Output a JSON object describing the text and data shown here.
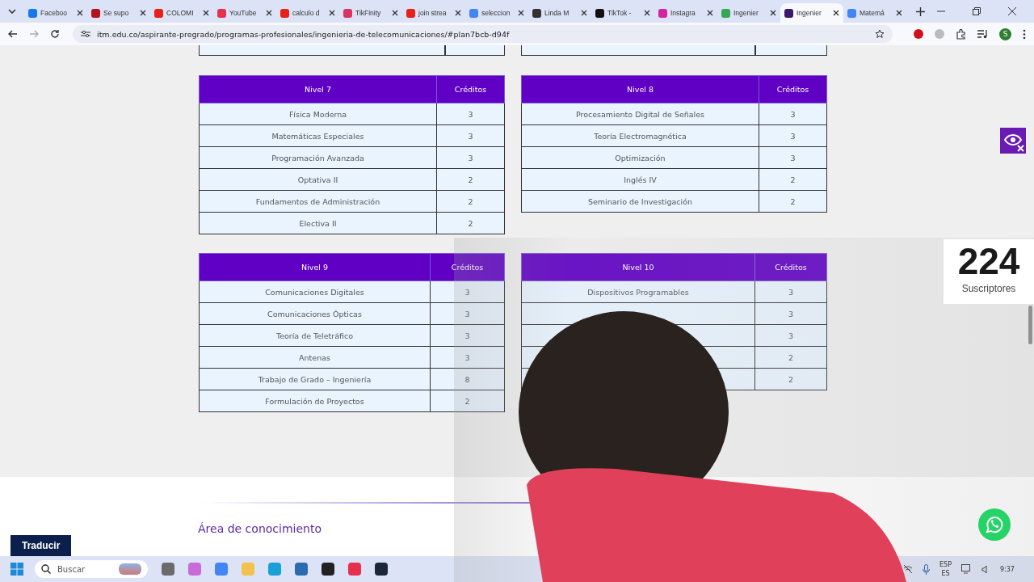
{
  "browser": {
    "tabs": [
      {
        "title": "Faceboo",
        "color": "#1877f2",
        "selected": false
      },
      {
        "title": "Se supo",
        "color": "#b3121b",
        "selected": false
      },
      {
        "title": "COLOMI",
        "color": "#e62117",
        "selected": false
      },
      {
        "title": "YouTube",
        "color": "#e6304d",
        "selected": false
      },
      {
        "title": "calculo d",
        "color": "#e62117",
        "selected": false
      },
      {
        "title": "TikFinity",
        "color": "#d8345f",
        "selected": false
      },
      {
        "title": "join strea",
        "color": "#e62117",
        "selected": false
      },
      {
        "title": "seleccion",
        "color": "#4285f4",
        "selected": false
      },
      {
        "title": "Linda M",
        "color": "#333333",
        "selected": false
      },
      {
        "title": "TikTok -",
        "color": "#111111",
        "selected": false
      },
      {
        "title": "Instagra",
        "color": "#d6249f",
        "selected": false
      },
      {
        "title": "Ingenier",
        "color": "#34a853",
        "selected": false
      },
      {
        "title": "Ingenier",
        "color": "#3b1a6e",
        "selected": true
      },
      {
        "title": "Matemá",
        "color": "#4285f4",
        "selected": false
      }
    ],
    "url": "itm.edu.co/aspirante-pregrado/programas-profesionales/ingenieria-de-telecomunicaciones/#plan7bcb-d94f",
    "profile_initial": "S"
  },
  "tables": [
    {
      "heading": "Nivel 7",
      "credits_heading": "Créditos",
      "rows": [
        {
          "course": "Física Moderna",
          "credits": "3"
        },
        {
          "course": "Matemáticas Especiales",
          "credits": "3"
        },
        {
          "course": "Programación Avanzada",
          "credits": "3"
        },
        {
          "course": "Optativa II",
          "credits": "2"
        },
        {
          "course": "Fundamentos de Administración",
          "credits": "2"
        },
        {
          "course": "Electiva II",
          "credits": "2"
        }
      ]
    },
    {
      "heading": "Nivel 8",
      "credits_heading": "Créditos",
      "rows": [
        {
          "course": "Procesamiento Digital de Señales",
          "credits": "3"
        },
        {
          "course": "Teoría Electromagnética",
          "credits": "3"
        },
        {
          "course": "Optimización",
          "credits": "3"
        },
        {
          "course": "Inglés IV",
          "credits": "2"
        },
        {
          "course": "Seminario de Investigación",
          "credits": "2"
        }
      ]
    },
    {
      "heading": "Nivel 9",
      "credits_heading": "Créditos",
      "rows": [
        {
          "course": "Comunicaciones Digitales",
          "credits": "3"
        },
        {
          "course": "Comunicaciones Ópticas",
          "credits": "3"
        },
        {
          "course": "Teoría de Teletráfico",
          "credits": "3"
        },
        {
          "course": "Antenas",
          "credits": "3"
        },
        {
          "course": "Trabajo de Grado – Ingeniería",
          "credits": "8"
        },
        {
          "course": "Formulación de Proyectos",
          "credits": "2"
        }
      ]
    },
    {
      "heading": "Nivel 10",
      "credits_heading": "Créditos",
      "rows": [
        {
          "course": "Dispositivos Programables",
          "credits": "3"
        },
        {
          "credits": "3"
        },
        {
          "credits": "3"
        },
        {
          "credits": "2"
        },
        {
          "credits": "2"
        }
      ]
    }
  ],
  "section_heading": "Área de conocimiento",
  "translate_button": "Traducir",
  "subscriber_widget": {
    "count": "224",
    "label": "Suscriptores"
  },
  "taskbar": {
    "search_placeholder": "Buscar",
    "language": "ESP",
    "layout": "ES",
    "time": "9:37"
  }
}
